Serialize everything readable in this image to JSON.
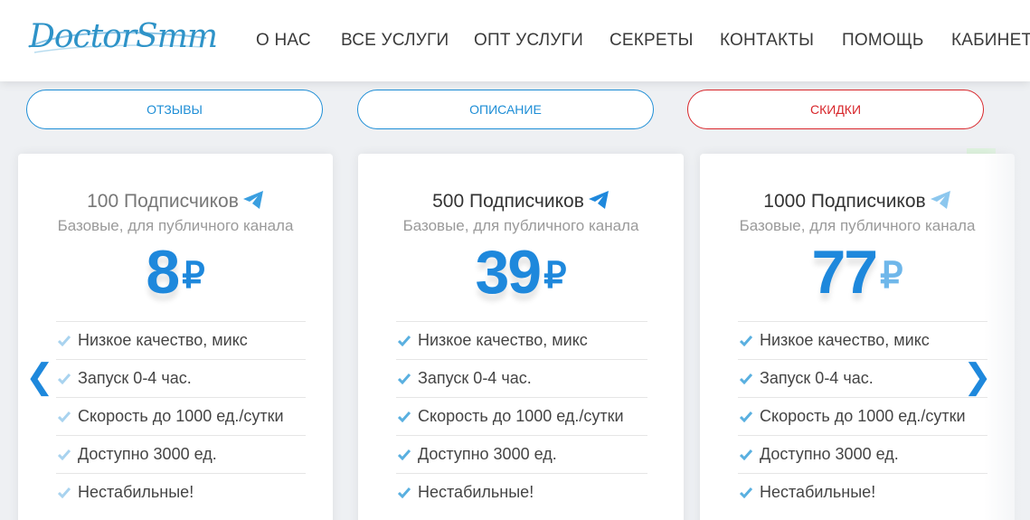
{
  "logo": {
    "text": "DoctorSmm"
  },
  "nav": {
    "items": [
      {
        "label": "О НАС"
      },
      {
        "label": "ВСЕ УСЛУГИ"
      },
      {
        "label": "ОПТ УСЛУГИ"
      },
      {
        "label": "СЕКРЕТЫ"
      },
      {
        "label": "КОНТАКТЫ"
      },
      {
        "label": "ПОМОЩЬ"
      },
      {
        "label": "КАБИНЕТ"
      }
    ]
  },
  "tabs": [
    {
      "label": "ОТЗЫВЫ",
      "color": "#1e8ed6"
    },
    {
      "label": "ОПИСАНИЕ",
      "color": "#1e8ed6"
    },
    {
      "label": "СКИДКИ",
      "color": "#d8262b"
    }
  ],
  "cards": [
    {
      "title": "100 Подписчиков",
      "subtitle": "Базовые, для публичного канала",
      "price": "8",
      "currency": "₽",
      "features": [
        "Низкое качество, микс",
        "Запуск 0-4 час.",
        "Скорость до 1000 ед./сутки",
        "Доступно 3000 ед.",
        "Нестабильные!"
      ]
    },
    {
      "title": "500 Подписчиков",
      "subtitle": "Базовые, для публичного канала",
      "price": "39",
      "currency": "₽",
      "features": [
        "Низкое качество, микс",
        "Запуск 0-4 час.",
        "Скорость до 1000 ед./сутки",
        "Доступно 3000 ед.",
        "Нестабильные!"
      ]
    },
    {
      "title": "1000 Подписчиков",
      "subtitle": "Базовые, для публичного канала",
      "price": "77",
      "currency": "₽",
      "features": [
        "Низкое качество, микс",
        "Запуск 0-4 час.",
        "Скорость до 1000 ед./сутки",
        "Доступно 3000 ед.",
        "Нестабильные!"
      ]
    }
  ],
  "arrows": {
    "prev": "❮",
    "next": "❯"
  },
  "colors": {
    "accent": "#1e88dc",
    "danger": "#d8262b",
    "check": "#5ab0e0"
  },
  "icons": {
    "card_title": "telegram-icon",
    "feature": "check-icon",
    "prev": "chevron-left-icon",
    "next": "chevron-right-icon"
  }
}
